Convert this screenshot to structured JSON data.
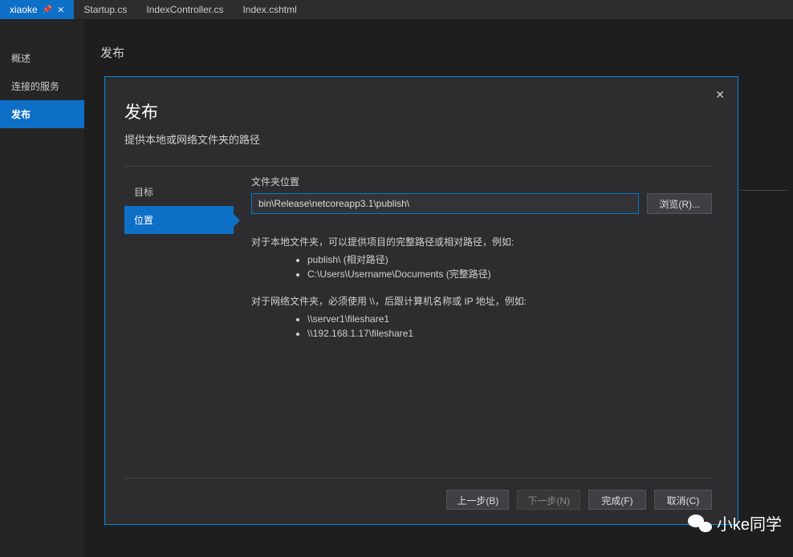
{
  "tabs": [
    {
      "label": "xiaoke",
      "active": true,
      "pinned": true,
      "closable": true
    },
    {
      "label": "Startup.cs",
      "active": false
    },
    {
      "label": "IndexController.cs",
      "active": false
    },
    {
      "label": "Index.cshtml",
      "active": false
    }
  ],
  "leftNav": {
    "items": [
      {
        "label": "概述",
        "selected": false
      },
      {
        "label": "连接的服务",
        "selected": false
      },
      {
        "label": "发布",
        "selected": true
      }
    ]
  },
  "pageTitle": "发布",
  "dialog": {
    "title": "发布",
    "subtitle": "提供本地或网络文件夹的路径",
    "steps": [
      {
        "label": "目标",
        "active": false
      },
      {
        "label": "位置",
        "active": true
      }
    ],
    "folder": {
      "label": "文件夹位置",
      "value": "bin\\Release\\netcoreapp3.1\\publish\\",
      "browseLabel": "浏览(R)..."
    },
    "help1": {
      "intro": "对于本地文件夹，可以提供项目的完整路径或相对路径，例如:",
      "items": [
        "publish\\ (相对路径)",
        "C:\\Users\\Username\\Documents (完整路径)"
      ]
    },
    "help2": {
      "intro": "对于网络文件夹，必须使用 \\\\，后跟计算机名称或 IP 地址，例如:",
      "items": [
        "\\\\server1\\fileshare1",
        "\\\\192.168.1.17\\fileshare1"
      ]
    },
    "buttons": {
      "back": "上一步(B)",
      "next": "下一步(N)",
      "finish": "完成(F)",
      "cancel": "取消(C)"
    }
  },
  "watermark": "小ke同学"
}
